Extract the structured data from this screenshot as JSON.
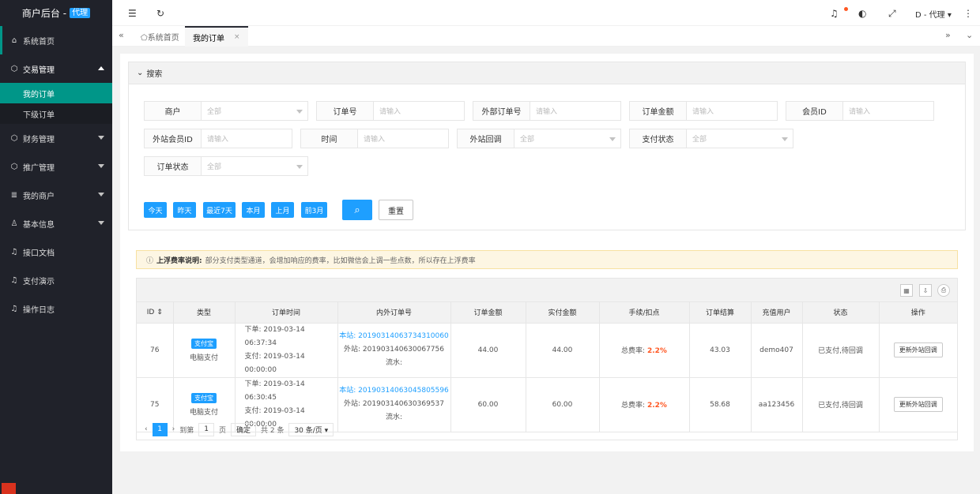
{
  "brand": {
    "title": "商户后台 -",
    "tag": "代理"
  },
  "sidebar": {
    "items": [
      {
        "label": "系统首页",
        "icon": "home-icon",
        "glyph": "⌂"
      },
      {
        "label": "交易管理",
        "icon": "cube-icon",
        "glyph": "⬡"
      },
      {
        "label": "财务管理",
        "icon": "cube-icon",
        "glyph": "⬡"
      },
      {
        "label": "推广管理",
        "icon": "cube-icon",
        "glyph": "⬡"
      },
      {
        "label": "我的商户",
        "icon": "list-icon",
        "glyph": "≣"
      },
      {
        "label": "基本信息",
        "icon": "user-icon",
        "glyph": "♙"
      },
      {
        "label": "接口文档",
        "icon": "bell-icon",
        "glyph": "♫"
      },
      {
        "label": "支付演示",
        "icon": "bell-icon",
        "glyph": "♫"
      },
      {
        "label": "操作日志",
        "icon": "bell-icon",
        "glyph": "♫"
      }
    ],
    "sub": [
      {
        "label": "我的订单"
      },
      {
        "label": "下级订单"
      }
    ]
  },
  "header": {
    "user": "D - 代理 ▾",
    "more": "⋮"
  },
  "tabs": [
    {
      "label": "⬠系统首页"
    },
    {
      "label": "我的订单",
      "close": "×"
    }
  ],
  "search": {
    "title": "搜索",
    "fields": {
      "merchant": {
        "label": "商户",
        "value": "全部"
      },
      "order_no": {
        "label": "订单号",
        "placeholder": "请输入"
      },
      "ext_order_no": {
        "label": "外部订单号",
        "placeholder": "请输入"
      },
      "amount": {
        "label": "订单金额",
        "placeholder": "请输入"
      },
      "member_id": {
        "label": "会员ID",
        "placeholder": "请输入"
      },
      "ext_member_id": {
        "label": "外站会员ID",
        "placeholder": "请输入"
      },
      "time": {
        "label": "时间",
        "placeholder": "请输入"
      },
      "callback": {
        "label": "外站回调",
        "value": "全部"
      },
      "pay_status": {
        "label": "支付状态",
        "value": "全部"
      },
      "order_status": {
        "label": "订单状态",
        "value": "全部"
      }
    },
    "quick": [
      "今天",
      "昨天",
      "最近7天",
      "本月",
      "上月",
      "前3月"
    ],
    "reset": "重置"
  },
  "notice": {
    "title": "上浮费率说明:",
    "text": "部分支付类型通道，会增加响应的费率，比如微信会上调一些点数，所以存在上浮费率"
  },
  "table": {
    "headers": [
      "ID",
      "类型",
      "订单时间",
      "内外订单号",
      "订单金额",
      "实付金额",
      "手续/扣点",
      "订单结算",
      "充值用户",
      "状态",
      "操作"
    ],
    "rows": [
      {
        "id": "76",
        "badge": "支付宝",
        "type": "电脑支付",
        "t1": "下单: 2019-03-14 06:37:34",
        "t2": "支付: 2019-03-14 00:00:00",
        "inner": "本站: 20190314063734310060",
        "outer": "外站: 201903140630067756",
        "flow": "流水:",
        "amount": "44.00",
        "paid": "44.00",
        "fee_label": "总费率:",
        "fee": "2.2%",
        "settle": "43.03",
        "user": "demo407",
        "status": "已支付,待回调",
        "op": "更新外站回调"
      },
      {
        "id": "75",
        "badge": "支付宝",
        "type": "电脑支付",
        "t1": "下单: 2019-03-14 06:30:45",
        "t2": "支付: 2019-03-14 00:00:00",
        "inner": "本站: 20190314063045805596",
        "outer": "外站: 201903140630369537",
        "flow": "流水:",
        "amount": "60.00",
        "paid": "60.00",
        "fee_label": "总费率:",
        "fee": "2.2%",
        "settle": "58.68",
        "user": "aa123456",
        "status": "已支付,待回调",
        "op": "更新外站回调"
      }
    ]
  },
  "pager": {
    "current": "1",
    "goto": "到第",
    "page_value": "1",
    "page_unit": "页",
    "confirm": "确定",
    "total": "共 2 条",
    "size": "30 条/页 ▾"
  }
}
